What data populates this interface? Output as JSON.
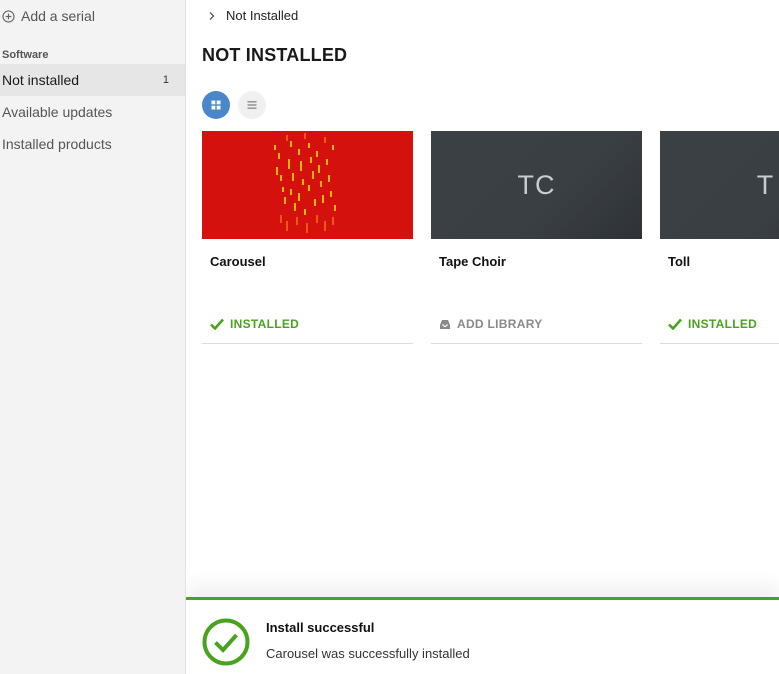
{
  "sidebar": {
    "add_serial_label": "Add a serial",
    "section_label": "Software",
    "items": [
      {
        "label": "Not installed",
        "count": "1"
      },
      {
        "label": "Available updates",
        "count": ""
      },
      {
        "label": "Installed products",
        "count": ""
      }
    ]
  },
  "breadcrumb": {
    "current": "Not Installed"
  },
  "page": {
    "title": "NOT INSTALLED"
  },
  "cards": [
    {
      "name": "Carousel",
      "initials": "",
      "status": "INSTALLED"
    },
    {
      "name": "Tape Choir",
      "initials": "TC",
      "status": "ADD LIBRARY"
    },
    {
      "name": "Toll",
      "initials": "T",
      "status": "INSTALLED"
    }
  ],
  "toast": {
    "title": "Install successful",
    "message": "Carousel was successfully installed"
  },
  "colors": {
    "accent_blue": "#4a87c9",
    "success_green": "#4aa31e",
    "thumb_red": "#d4110c",
    "thumb_gray": "#3a3f43"
  }
}
